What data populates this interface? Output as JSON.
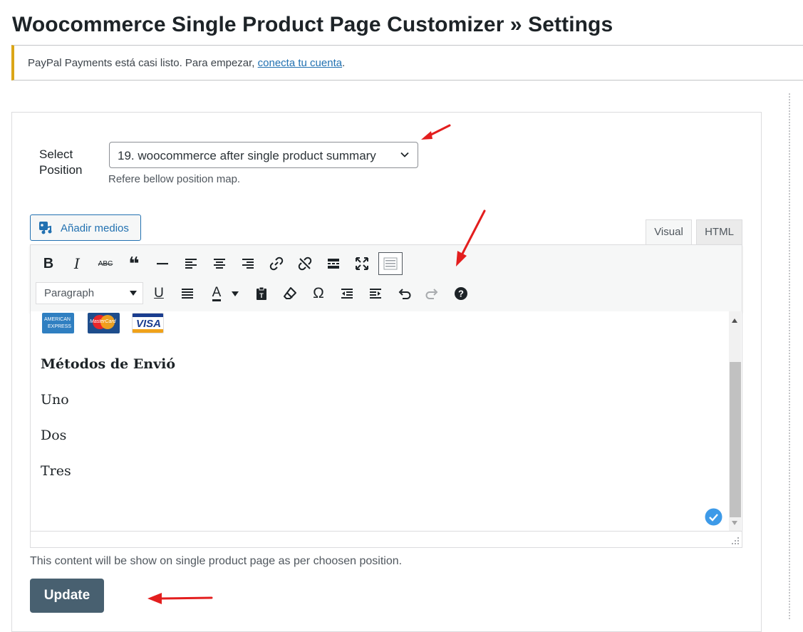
{
  "page": {
    "title": "Woocommerce Single Product Page Customizer » Settings"
  },
  "notice": {
    "text": "PayPal Payments está casi listo. Para empezar, ",
    "link": "conecta tu cuenta",
    "suffix": ".",
    "accent_color": "#dba617"
  },
  "position": {
    "label_line1": "Select",
    "label_line2": "Position",
    "selected": "19. woocommerce after single product summary",
    "hint": "Refere bellow position map."
  },
  "editor": {
    "add_media_label": "Añadir medios",
    "tabs": [
      {
        "label": "Visual",
        "active": true
      },
      {
        "label": "HTML",
        "active": false
      }
    ],
    "toolbar_row1": [
      "bold-icon",
      "italic-icon",
      "strikethrough-icon",
      "blockquote-icon",
      "horizontal-rule-icon",
      "align-left-icon",
      "align-center-icon",
      "align-right-icon",
      "link-icon",
      "unlink-icon",
      "read-more-icon",
      "fullscreen-icon",
      "toolbar-toggle-icon"
    ],
    "toolbar_row2": [
      "underline-icon",
      "justify-icon",
      "text-color-icon",
      "paste-text-icon",
      "clear-formatting-icon",
      "special-character-icon",
      "outdent-icon",
      "indent-icon",
      "undo-icon",
      "redo-icon",
      "help-icon"
    ],
    "format_selected": "Paragraph",
    "glyphs": {
      "bold": "B",
      "italic": "I",
      "strike": "ABC",
      "quote": "❝",
      "underline": "U",
      "text_color": "A",
      "omega": "Ω",
      "help": "?"
    },
    "card_labels": {
      "amex_line1": "AMERICAN",
      "amex_line2": "EXPRESS",
      "mastercard": "MasterCard",
      "visa": "VISA"
    },
    "content": {
      "heading": "Métodos de Envió",
      "items": [
        "Uno",
        "Dos",
        "Tres"
      ]
    },
    "description": "This content will be show on single product page as per choosen position."
  },
  "actions": {
    "update_label": "Update",
    "button_color": "#486070"
  },
  "annotations": {
    "arrow_color": "#e31e1e"
  }
}
